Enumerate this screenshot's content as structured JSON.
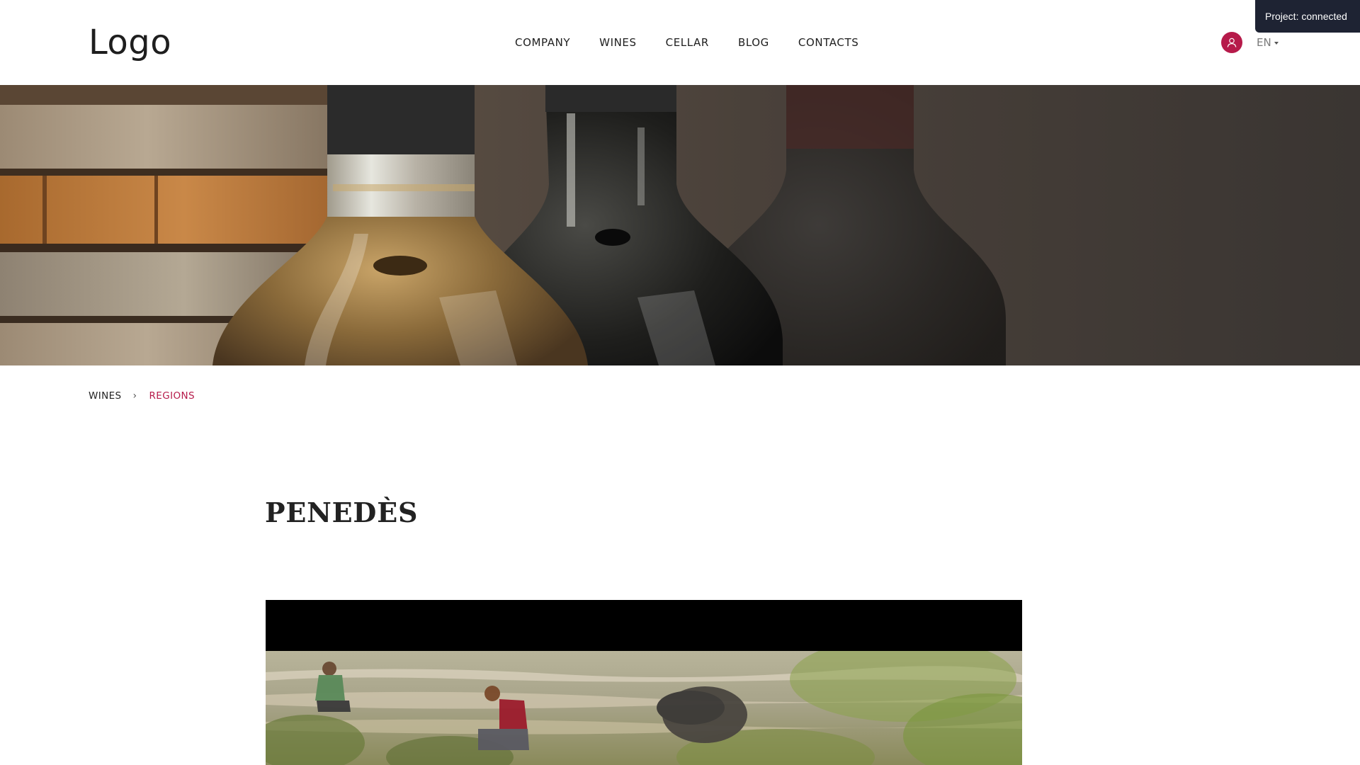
{
  "status": {
    "text": "Project: connected"
  },
  "header": {
    "logo": "Logo",
    "nav": [
      {
        "label": "COMPANY"
      },
      {
        "label": "WINES"
      },
      {
        "label": "CELLAR"
      },
      {
        "label": "BLOG"
      },
      {
        "label": "CONTACTS"
      }
    ],
    "user_icon": "user-icon",
    "language": "EN"
  },
  "hero": {
    "image": "wine-bottles-hero"
  },
  "breadcrumb": {
    "items": [
      {
        "label": "WINES"
      },
      {
        "label": "REGIONS"
      }
    ],
    "separator": "›"
  },
  "main": {
    "title": "PENEDÈS"
  },
  "video": {
    "image": "vineyard-workers-video"
  },
  "colors": {
    "accent": "#b61a4a",
    "status_bg": "#1e2333",
    "text": "#1e1e1e"
  }
}
